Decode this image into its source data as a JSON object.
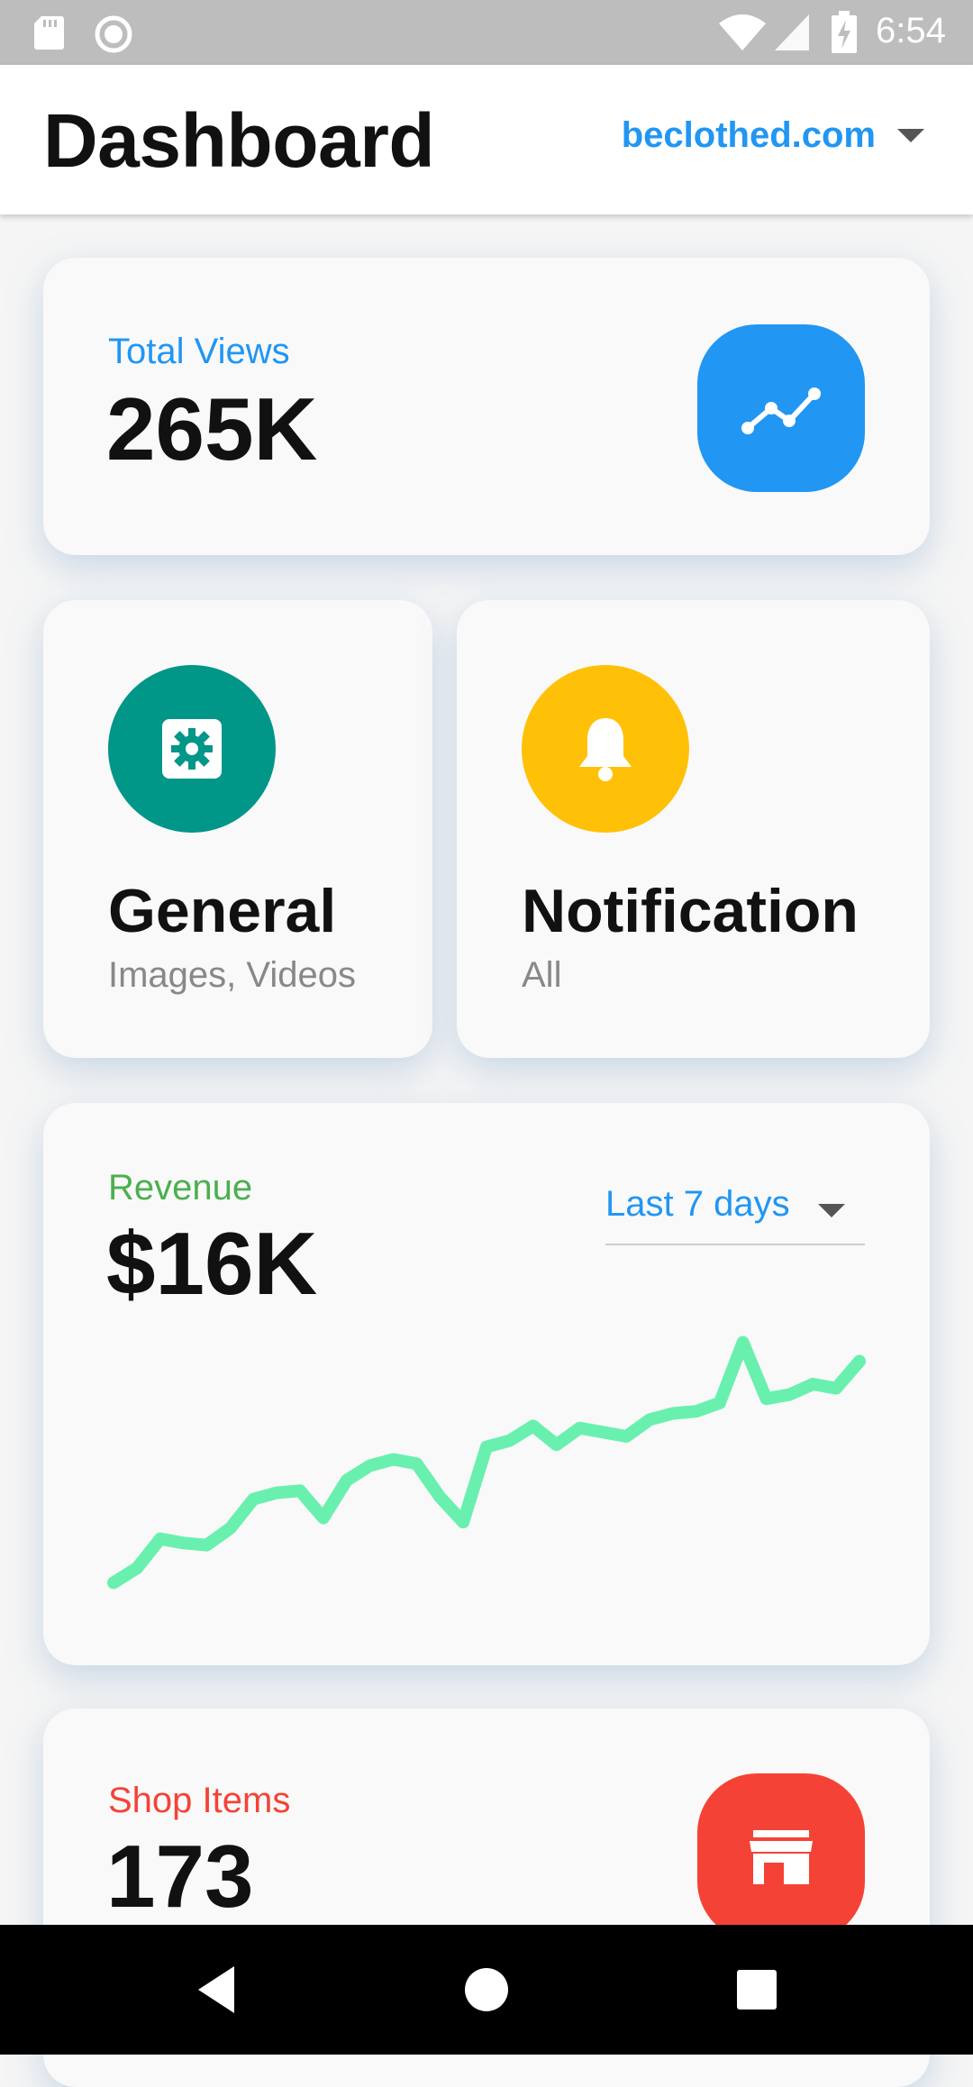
{
  "status_bar": {
    "time": "6:54"
  },
  "header": {
    "title": "Dashboard",
    "site": "beclothed.com"
  },
  "views_card": {
    "label": "Total Views",
    "value": "265K",
    "icon": "trending-up-icon",
    "color": "#2196f3"
  },
  "tiles": [
    {
      "title": "General",
      "subtitle": "Images, Videos",
      "icon": "settings-icon",
      "color": "#009688"
    },
    {
      "title": "Notification",
      "subtitle": "All",
      "icon": "bell-icon",
      "color": "#ffc107"
    }
  ],
  "revenue_card": {
    "label": "Revenue",
    "value": "$16K",
    "range": "Last 7 days",
    "label_color": "#4caf50",
    "line_color": "#69f0ae"
  },
  "shop_card": {
    "label": "Shop Items",
    "value": "173",
    "icon": "store-icon",
    "color": "#f44336"
  },
  "chart_data": {
    "type": "line",
    "series": [
      {
        "values": [
          5,
          12,
          26,
          24,
          23,
          31,
          45,
          48,
          49,
          36,
          54,
          61,
          64,
          62,
          46,
          34,
          70,
          73,
          80,
          71,
          79,
          77,
          75,
          83,
          86,
          87,
          91,
          120,
          93,
          95,
          100,
          98,
          111
        ]
      }
    ]
  }
}
